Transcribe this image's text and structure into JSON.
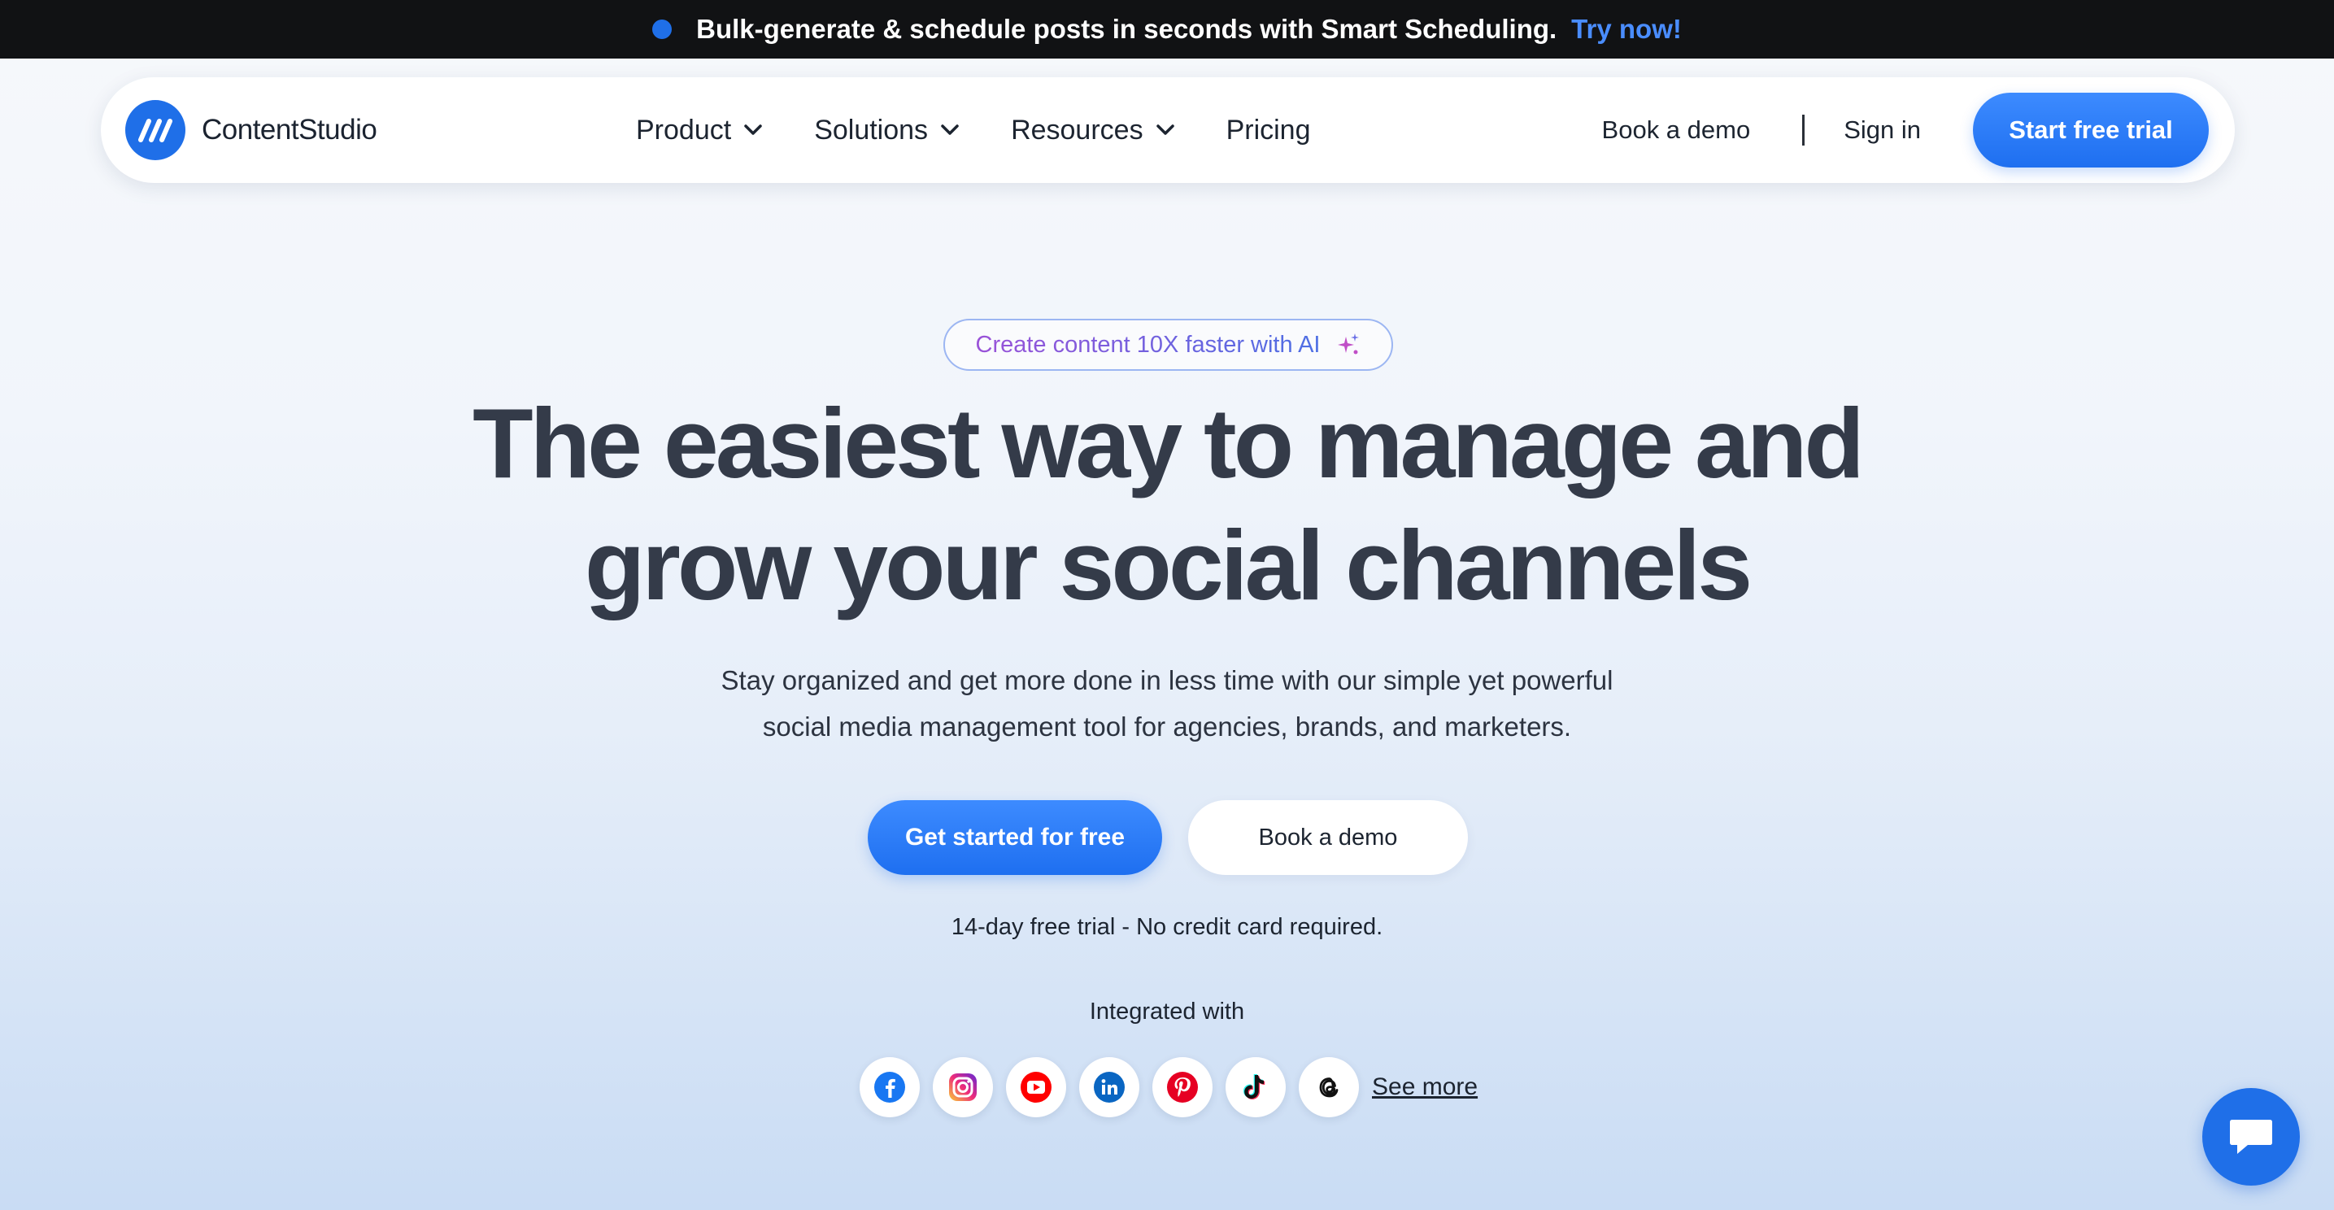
{
  "announcement": {
    "text": "Bulk-generate & schedule posts in seconds with Smart Scheduling.",
    "link": "Try now!"
  },
  "nav": {
    "brand": "ContentStudio",
    "menu": [
      {
        "label": "Product",
        "has_dropdown": true
      },
      {
        "label": "Solutions",
        "has_dropdown": true
      },
      {
        "label": "Resources",
        "has_dropdown": true
      },
      {
        "label": "Pricing",
        "has_dropdown": false
      }
    ],
    "book_demo": "Book a demo",
    "sign_in": "Sign in",
    "cta": "Start free trial"
  },
  "hero": {
    "badge": "Create content 10X faster with AI",
    "headline_line1": "The easiest way to manage and",
    "headline_line2": "grow your social channels",
    "subtext_line1": "Stay organized and get more done in less time with our simple yet powerful",
    "subtext_line2": "social media management tool for agencies, brands, and marketers.",
    "primary_cta": "Get started for free",
    "secondary_cta": "Book a demo",
    "trial_note": "14-day free trial - No credit card required.",
    "integrated_label": "Integrated with",
    "see_more": "See more"
  },
  "social_icons": [
    "facebook-icon",
    "instagram-icon",
    "youtube-icon",
    "linkedin-icon",
    "pinterest-icon",
    "tiktok-icon",
    "threads-icon"
  ],
  "colors": {
    "accent": "#1f6fe8",
    "link": "#4a8dff",
    "topbar": "#111214",
    "heading": "#343b49"
  }
}
